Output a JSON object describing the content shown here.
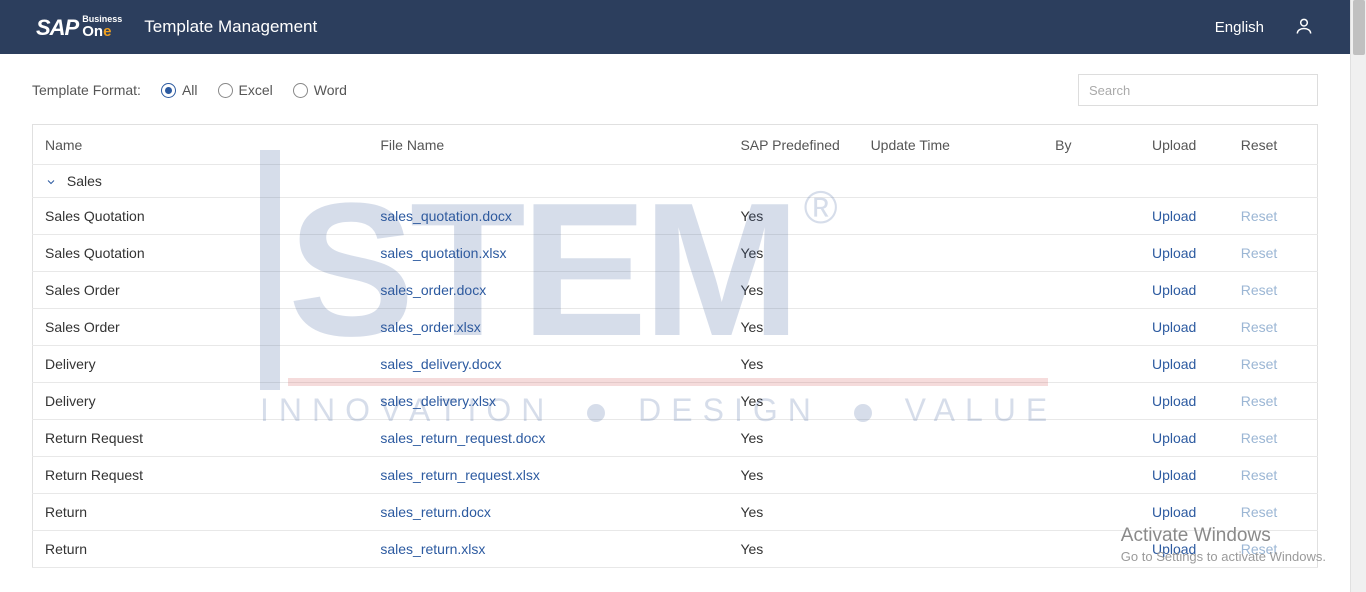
{
  "header": {
    "logo_sap": "SAP",
    "logo_business": "Business",
    "logo_one_prefix": "On",
    "logo_one_suffix": "e",
    "page_title": "Template Management",
    "language": "English"
  },
  "filter": {
    "label": "Template Format:",
    "options": [
      {
        "label": "All",
        "selected": true
      },
      {
        "label": "Excel",
        "selected": false
      },
      {
        "label": "Word",
        "selected": false
      }
    ]
  },
  "search": {
    "placeholder": "Search",
    "value": ""
  },
  "columns": {
    "name": "Name",
    "file_name": "File Name",
    "sap_predefined": "SAP Predefined",
    "update_time": "Update Time",
    "by": "By",
    "upload": "Upload",
    "reset": "Reset"
  },
  "group": {
    "label": "Sales"
  },
  "rows": [
    {
      "name": "Sales Quotation",
      "file": "sales_quotation.docx",
      "sap": "Yes",
      "time": "",
      "by": "",
      "upload": "Upload",
      "reset": "Reset"
    },
    {
      "name": "Sales Quotation",
      "file": "sales_quotation.xlsx",
      "sap": "Yes",
      "time": "",
      "by": "",
      "upload": "Upload",
      "reset": "Reset"
    },
    {
      "name": "Sales Order",
      "file": "sales_order.docx",
      "sap": "Yes",
      "time": "",
      "by": "",
      "upload": "Upload",
      "reset": "Reset"
    },
    {
      "name": "Sales Order",
      "file": "sales_order.xlsx",
      "sap": "Yes",
      "time": "",
      "by": "",
      "upload": "Upload",
      "reset": "Reset"
    },
    {
      "name": "Delivery",
      "file": "sales_delivery.docx",
      "sap": "Yes",
      "time": "",
      "by": "",
      "upload": "Upload",
      "reset": "Reset"
    },
    {
      "name": "Delivery",
      "file": "sales_delivery.xlsx",
      "sap": "Yes",
      "time": "",
      "by": "",
      "upload": "Upload",
      "reset": "Reset"
    },
    {
      "name": "Return Request",
      "file": "sales_return_request.docx",
      "sap": "Yes",
      "time": "",
      "by": "",
      "upload": "Upload",
      "reset": "Reset"
    },
    {
      "name": "Return Request",
      "file": "sales_return_request.xlsx",
      "sap": "Yes",
      "time": "",
      "by": "",
      "upload": "Upload",
      "reset": "Reset"
    },
    {
      "name": "Return",
      "file": "sales_return.docx",
      "sap": "Yes",
      "time": "",
      "by": "",
      "upload": "Upload",
      "reset": "Reset"
    },
    {
      "name": "Return",
      "file": "sales_return.xlsx",
      "sap": "Yes",
      "time": "",
      "by": "",
      "upload": "Upload",
      "reset": "Reset"
    }
  ],
  "watermark": {
    "brand": "STEM",
    "reg": "®",
    "tag_a": "INNOVATION",
    "tag_b": "DESIGN",
    "tag_c": "VALUE"
  },
  "activation": {
    "line1": "Activate Windows",
    "line2": "Go to Settings to activate Windows."
  }
}
